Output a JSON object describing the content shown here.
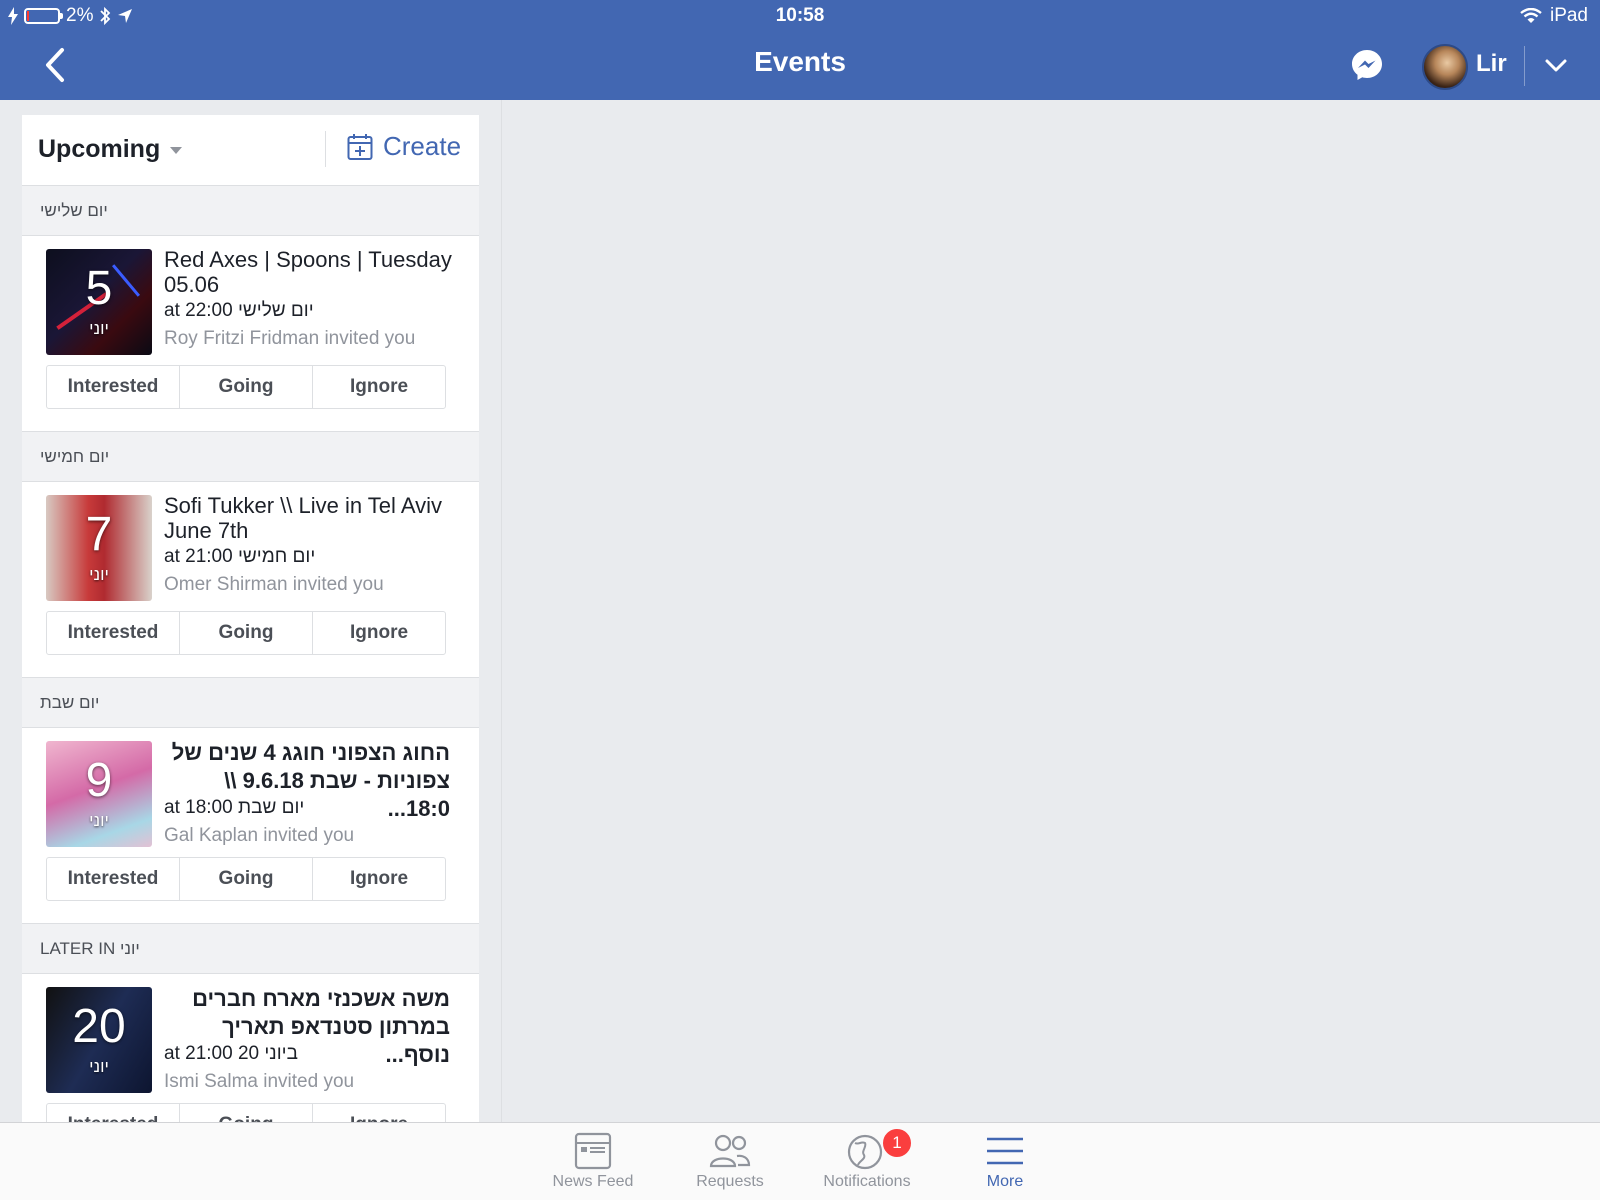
{
  "status_bar": {
    "battery": "2%",
    "time": "10:58",
    "device": "iPad"
  },
  "nav": {
    "title": "Events",
    "username": "Lir"
  },
  "list_header": {
    "filter_label": "Upcoming",
    "create_label": "Create"
  },
  "sections": [
    {
      "label": "יום שלישי",
      "event": {
        "day": "5",
        "month": "יוני",
        "title": "Red Axes | Spoons | Tuesday 05.06",
        "time": "at 22:00 יום שלישי",
        "invited_by": "Roy Fritzi Fridman invited you"
      }
    },
    {
      "label": "יום חמישי",
      "event": {
        "day": "7",
        "month": "יוני",
        "title": "Sofi Tukker \\\\ Live in Tel Aviv June 7th",
        "time": "at 21:00 יום חמישי",
        "invited_by": "Omer Shirman invited you"
      }
    },
    {
      "label": "יום שבת",
      "event": {
        "day": "9",
        "month": "יוני",
        "title": "החוג הצפוני חוגג 4 שנים של צפוניות - שבת 9.6.18 \\\\ 18:0...",
        "time": "at 18:00 יום שבת",
        "invited_by": "Gal Kaplan invited you"
      }
    },
    {
      "label": "LATER IN יוני",
      "event": {
        "day": "20",
        "month": "יוני",
        "title": "משה אשכנזי מארח חברים במרתון סטנדאפ תאריך נוסף...",
        "time": "at 21:00 20 ביוני",
        "invited_by": "Ismi Salma invited you"
      }
    }
  ],
  "rsvp": {
    "interested": "Interested",
    "going": "Going",
    "ignore": "Ignore"
  },
  "tabbar": {
    "items": [
      {
        "label": "News Feed",
        "icon": "news-feed-icon"
      },
      {
        "label": "Requests",
        "icon": "friends-icon"
      },
      {
        "label": "Notifications",
        "icon": "globe-icon",
        "badge": "1"
      },
      {
        "label": "More",
        "icon": "menu-icon",
        "active": true
      }
    ]
  },
  "colors": {
    "brand": "#4267b2",
    "background": "#e9ebee",
    "badge": "#fa3e3e"
  }
}
